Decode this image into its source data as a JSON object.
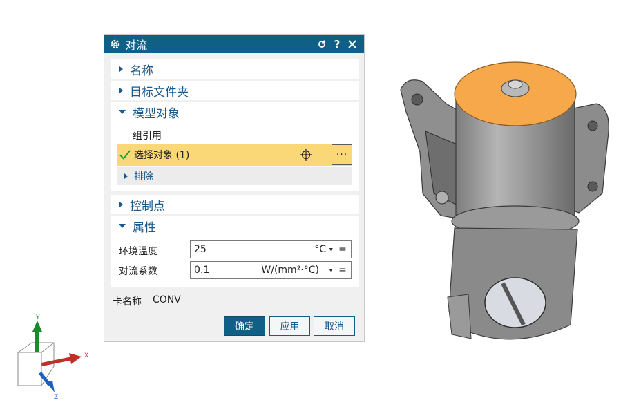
{
  "dialog": {
    "title": "对流",
    "buttons": {
      "reset": "reset-icon",
      "help": "?",
      "close": "close-icon"
    },
    "sections": {
      "name": "名称",
      "target_folder": "目标文件夹",
      "model_objects": "模型对象",
      "control_points": "控制点",
      "properties": "属性"
    },
    "model_objects": {
      "group_ref_label": "组引用",
      "group_ref_checked": false,
      "select_label": "选择对象 (1)",
      "more_label": "···",
      "exclude_label": "排除"
    },
    "properties": {
      "ambient_temp_label": "环境温度",
      "ambient_temp_value": "25",
      "ambient_temp_unit": "°C",
      "coef_label": "对流系数",
      "coef_value": "0.1",
      "coef_unit": "W/(mm²·°C)",
      "eq_symbol": "="
    },
    "card": {
      "label": "卡名称",
      "value": "CONV"
    },
    "footer": {
      "ok": "确定",
      "apply": "应用",
      "cancel": "取消"
    }
  },
  "triad": {
    "x": "X",
    "y": "Y",
    "z": "Z"
  },
  "colors": {
    "title_bar": "#0f5f86",
    "section_text": "#1b5a8a",
    "selection_highlight": "#fbd877",
    "selected_face": "#f6a84a",
    "model_gray": "#9a9a9a"
  }
}
